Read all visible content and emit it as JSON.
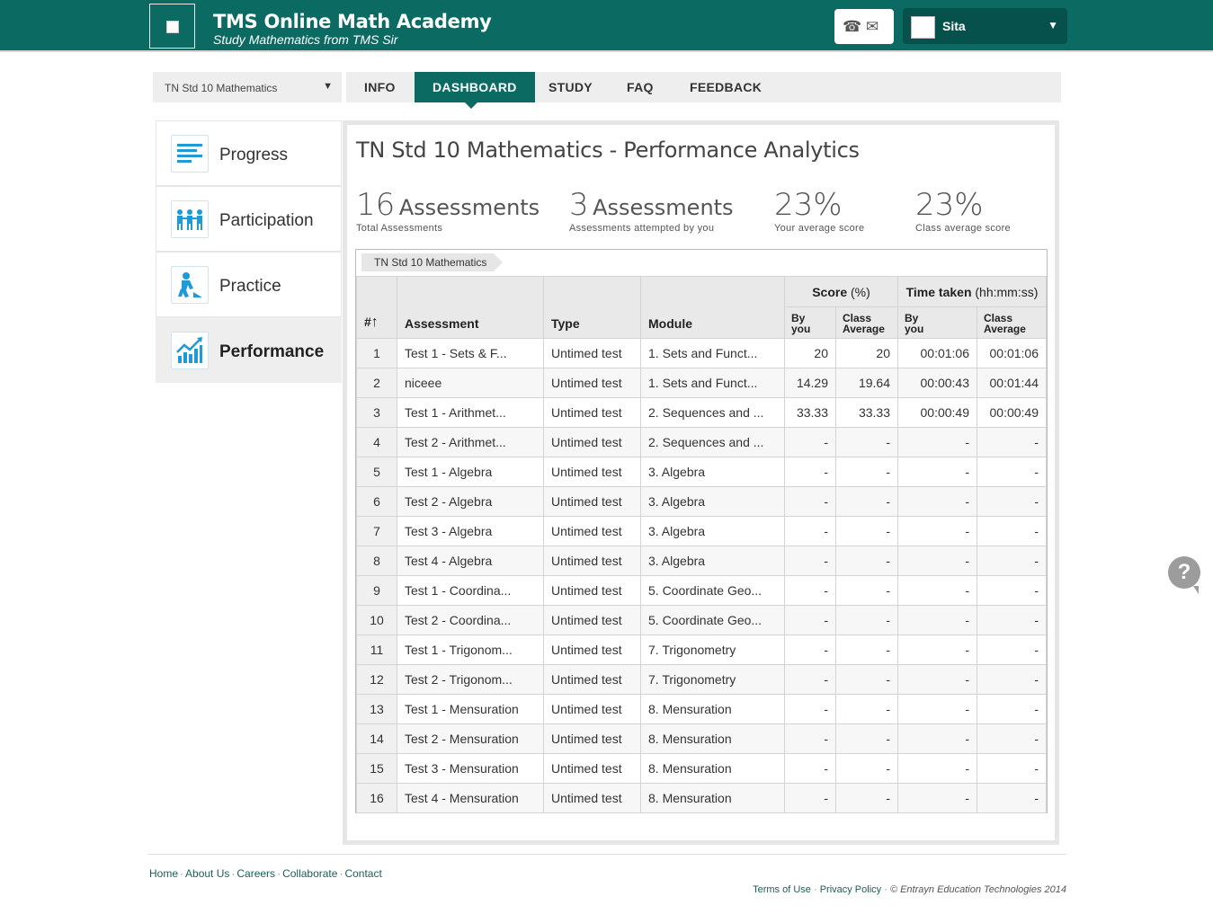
{
  "header": {
    "title": "TMS Online Math Academy",
    "subtitle": "Study Mathematics from TMS Sir",
    "user_name": "Sita",
    "brand_color": "#0b6b63"
  },
  "course_select": {
    "selected": "TN Std 10 Mathematics"
  },
  "tabs": [
    {
      "label": "INFO",
      "active": false
    },
    {
      "label": "DASHBOARD",
      "active": true
    },
    {
      "label": "STUDY",
      "active": false
    },
    {
      "label": "FAQ",
      "active": false
    },
    {
      "label": "FEEDBACK",
      "active": false
    }
  ],
  "sidebar": {
    "items": [
      {
        "label": "Progress",
        "icon": "progress-icon"
      },
      {
        "label": "Participation",
        "icon": "participation-icon"
      },
      {
        "label": "Practice",
        "icon": "practice-icon"
      },
      {
        "label": "Performance",
        "icon": "performance-icon",
        "active": true
      }
    ]
  },
  "main": {
    "title": "TN Std 10 Mathematics - Performance Analytics",
    "stats": [
      {
        "value": "16",
        "unit": "Assessments",
        "caption": "Total Assessments"
      },
      {
        "value": "3",
        "unit": "Assessments",
        "caption": "Assessments attempted by you"
      },
      {
        "value": "23%",
        "unit": "",
        "caption": "Your average score"
      },
      {
        "value": "23%",
        "unit": "",
        "caption": "Class average score"
      }
    ],
    "breadcrumb": "TN Std 10 Mathematics",
    "table": {
      "headers": {
        "num": "#",
        "sort_arrow": "↑",
        "assessment": "Assessment",
        "type": "Type",
        "module": "Module",
        "score": "Score",
        "score_unit": "(%)",
        "time": "Time taken",
        "time_unit": "(hh:mm:ss)",
        "by_you_1": "By",
        "by_you_2": "you",
        "class_avg_1": "Class",
        "class_avg_2": "Average"
      },
      "rows": [
        [
          "1",
          "Test 1 - Sets & F...",
          "Untimed test",
          "1. Sets and Funct...",
          "20",
          "20",
          "00:01:06",
          "00:01:06"
        ],
        [
          "2",
          "niceee",
          "Untimed test",
          "1. Sets and Funct...",
          "14.29",
          "19.64",
          "00:00:43",
          "00:01:44"
        ],
        [
          "3",
          "Test 1 - Arithmet...",
          "Untimed test",
          "2. Sequences and ...",
          "33.33",
          "33.33",
          "00:00:49",
          "00:00:49"
        ],
        [
          "4",
          "Test 2 - Arithmet...",
          "Untimed test",
          "2. Sequences and ...",
          "-",
          "-",
          "-",
          "-"
        ],
        [
          "5",
          "Test 1 - Algebra",
          "Untimed test",
          "3. Algebra",
          "-",
          "-",
          "-",
          "-"
        ],
        [
          "6",
          "Test 2 - Algebra",
          "Untimed test",
          "3. Algebra",
          "-",
          "-",
          "-",
          "-"
        ],
        [
          "7",
          "Test 3 - Algebra",
          "Untimed test",
          "3. Algebra",
          "-",
          "-",
          "-",
          "-"
        ],
        [
          "8",
          "Test 4 - Algebra",
          "Untimed test",
          "3. Algebra",
          "-",
          "-",
          "-",
          "-"
        ],
        [
          "9",
          "Test 1 - Coordina...",
          "Untimed test",
          "5. Coordinate Geo...",
          "-",
          "-",
          "-",
          "-"
        ],
        [
          "10",
          "Test 2 - Coordina...",
          "Untimed test",
          "5. Coordinate Geo...",
          "-",
          "-",
          "-",
          "-"
        ],
        [
          "11",
          "Test 1 - Trigonom...",
          "Untimed test",
          "7. Trigonometry",
          "-",
          "-",
          "-",
          "-"
        ],
        [
          "12",
          "Test 2 - Trigonom...",
          "Untimed test",
          "7. Trigonometry",
          "-",
          "-",
          "-",
          "-"
        ],
        [
          "13",
          "Test 1 - Mensuration",
          "Untimed test",
          "8. Mensuration",
          "-",
          "-",
          "-",
          "-"
        ],
        [
          "14",
          "Test 2 - Mensuration",
          "Untimed test",
          "8. Mensuration",
          "-",
          "-",
          "-",
          "-"
        ],
        [
          "15",
          "Test 3 - Mensuration",
          "Untimed test",
          "8. Mensuration",
          "-",
          "-",
          "-",
          "-"
        ],
        [
          "16",
          "Test 4 - Mensuration",
          "Untimed test",
          "8. Mensuration",
          "-",
          "-",
          "-",
          "-"
        ]
      ]
    }
  },
  "help_button": "?",
  "footer": {
    "links": [
      "Home",
      "About Us",
      "Careers",
      "Collaborate",
      "Contact"
    ],
    "terms": "Terms of Use",
    "privacy": "Privacy Policy",
    "copyright": "© Entrayn Education Technologies 2014"
  }
}
